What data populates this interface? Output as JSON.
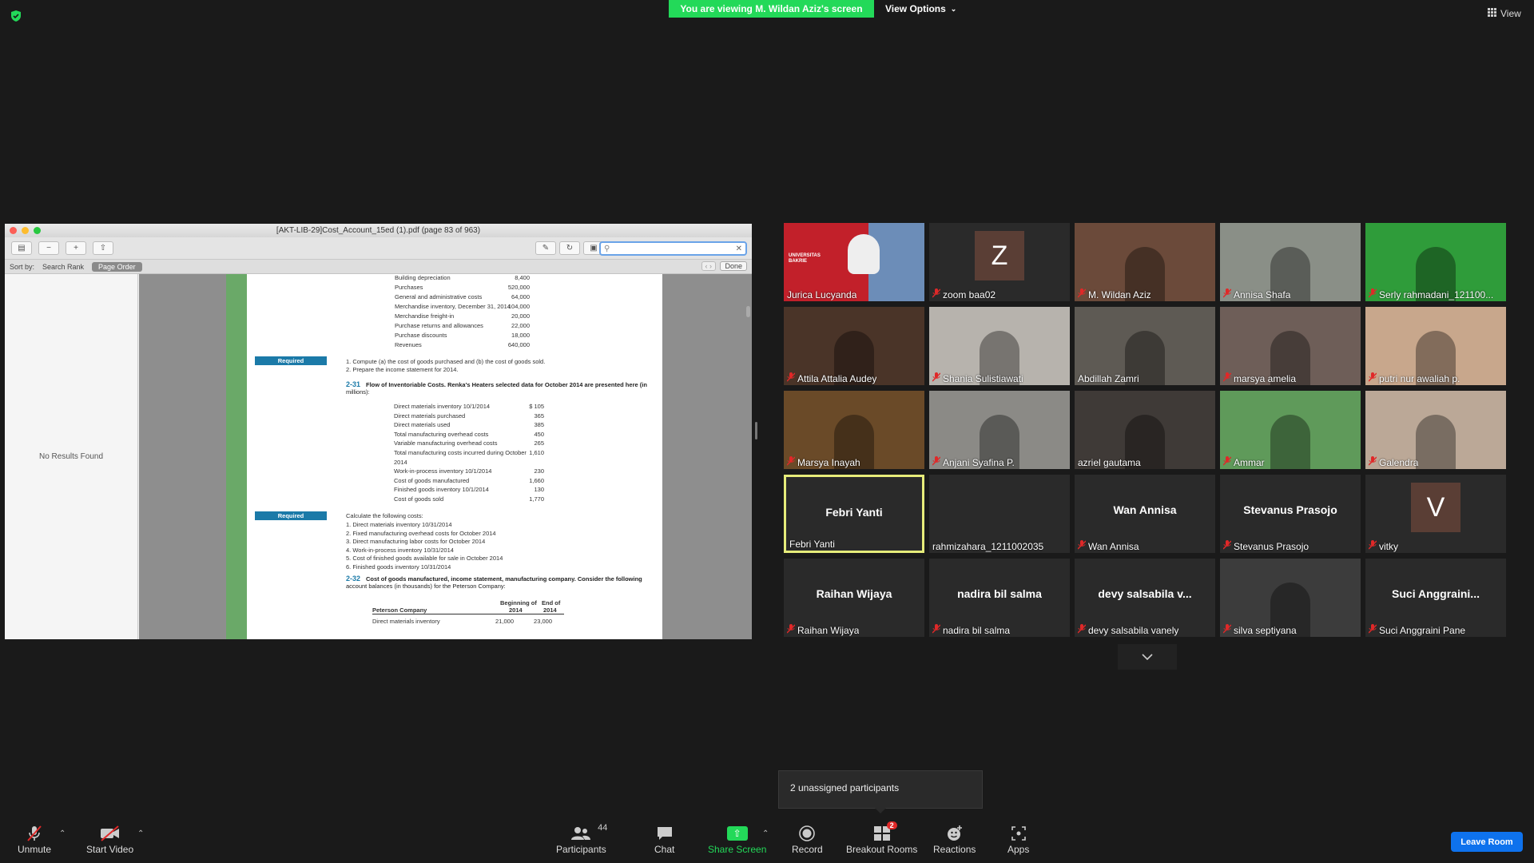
{
  "top": {
    "banner": "You are viewing M. Wildan Aziz's screen",
    "view_options": "View Options",
    "view": "View"
  },
  "shared_doc": {
    "title": "[AKT-LIB-29]Cost_Account_15ed (1).pdf (page 83 of 963)",
    "sort_by": "Sort by:",
    "sort_search_rank": "Search Rank",
    "sort_page_order": "Page Order",
    "done": "Done",
    "no_results": "No Results Found",
    "lines_top": [
      {
        "label": "Building depreciation",
        "value": "8,400"
      },
      {
        "label": "Purchases",
        "value": "520,000"
      },
      {
        "label": "General and administrative costs",
        "value": "64,000"
      },
      {
        "label": "Merchandise inventory, December 31, 2014",
        "value": "104,000"
      },
      {
        "label": "Merchandise freight-in",
        "value": "20,000"
      },
      {
        "label": "Purchase returns and allowances",
        "value": "22,000"
      },
      {
        "label": "Purchase discounts",
        "value": "18,000"
      },
      {
        "label": "Revenues",
        "value": "640,000"
      }
    ],
    "required_label": "Required",
    "req1_items": [
      "1. Compute (a) the cost of goods purchased and (b) the cost of goods sold.",
      "2. Prepare the income statement for 2014."
    ],
    "p231_num": "2-31",
    "p231_text": "Flow of Inventoriable Costs. Renka's Heaters selected data for October 2014 are presented here (in",
    "p231_text2": "millions):",
    "lines_231": [
      {
        "label": "Direct materials inventory 10/1/2014",
        "value": "$ 105"
      },
      {
        "label": "Direct materials purchased",
        "value": "365"
      },
      {
        "label": "Direct materials used",
        "value": "385"
      },
      {
        "label": "Total manufacturing overhead costs",
        "value": "450"
      },
      {
        "label": "Variable manufacturing overhead costs",
        "value": "265"
      },
      {
        "label": "Total manufacturing costs incurred during October",
        "value": "1,610"
      },
      {
        "label": "2014",
        "value": ""
      },
      {
        "label": "Work-in-process inventory 10/1/2014",
        "value": "230"
      },
      {
        "label": "Cost of goods manufactured",
        "value": "1,660"
      },
      {
        "label": "Finished goods inventory 10/1/2014",
        "value": "130"
      },
      {
        "label": "Cost of goods sold",
        "value": "1,770"
      }
    ],
    "calc_intro": "Calculate the following costs:",
    "req2_items": [
      "1. Direct materials inventory 10/31/2014",
      "2. Fixed manufacturing overhead costs for October 2014",
      "3. Direct manufacturing labor costs for October 2014",
      "4. Work-in-process inventory 10/31/2014",
      "5. Cost of finished goods available for sale in October 2014",
      "6. Finished goods inventory 10/31/2014"
    ],
    "p232_num": "2-32",
    "p232_text": "Cost of goods manufactured, income statement, manufacturing company. Consider the following",
    "p232_text2": "account balances (in thousands) for the Peterson Company:",
    "table_col1": "Beginning of",
    "table_col1b": "2014",
    "table_col2": "End of",
    "table_col2b": "2014",
    "table_company": "Peterson Company",
    "table_row1_label": "Direct materials inventory",
    "table_row1_v1": "21,000",
    "table_row1_v2": "23,000"
  },
  "participants_tiles": [
    {
      "name": "Jurica Lucyanda",
      "muted": false,
      "kind": "video",
      "bg": "#a31f1f"
    },
    {
      "name": "zoom baa02",
      "muted": true,
      "kind": "avatar",
      "initial": "Z"
    },
    {
      "name": "M. Wildan Aziz",
      "muted": true,
      "kind": "video",
      "bg": "#6b4a3a"
    },
    {
      "name": "Annisa Shafa",
      "muted": true,
      "kind": "video",
      "bg": "#8a8f87"
    },
    {
      "name": "Serly rahmadani_121100...",
      "muted": true,
      "kind": "video",
      "bg": "#2f9c3a"
    },
    {
      "name": "Attila Attalia Audey",
      "muted": true,
      "kind": "video",
      "bg": "#4a3428"
    },
    {
      "name": "Shania Sulistiawati",
      "muted": true,
      "kind": "video",
      "bg": "#b7b3ad"
    },
    {
      "name": "Abdillah Zamri",
      "muted": false,
      "kind": "video",
      "bg": "#5e5a54"
    },
    {
      "name": "marsya amelia",
      "muted": true,
      "kind": "video",
      "bg": "#6e5e58"
    },
    {
      "name": "putri nur awaliah p.",
      "muted": true,
      "kind": "video",
      "bg": "#c8a78c"
    },
    {
      "name": "Marsya Inayah",
      "muted": true,
      "kind": "video",
      "bg": "#6a4a28"
    },
    {
      "name": "Anjani Syafina P.",
      "muted": true,
      "kind": "video",
      "bg": "#8b8a86"
    },
    {
      "name": "azriel gautama",
      "muted": false,
      "kind": "video",
      "bg": "#3f3a37"
    },
    {
      "name": "Ammar",
      "muted": true,
      "kind": "video",
      "bg": "#5f9a5a"
    },
    {
      "name": "Galendra",
      "muted": true,
      "kind": "video",
      "bg": "#bba897"
    },
    {
      "name": "Febri Yanti",
      "muted": false,
      "kind": "name",
      "center": "Febri Yanti"
    },
    {
      "name": "rahmizahara_1211002035",
      "muted": false,
      "kind": "blank"
    },
    {
      "name": "Wan Annisa",
      "muted": true,
      "kind": "name",
      "center": "Wan Annisa"
    },
    {
      "name": "Stevanus Prasojo",
      "muted": true,
      "kind": "name",
      "center": "Stevanus Prasojo"
    },
    {
      "name": "vitky",
      "muted": true,
      "kind": "avatar",
      "initial": "V"
    },
    {
      "name": "Raihan Wijaya",
      "muted": true,
      "kind": "name",
      "center": "Raihan Wijaya"
    },
    {
      "name": "nadira bil salma",
      "muted": true,
      "kind": "name",
      "center": "nadira bil salma"
    },
    {
      "name": "devy salsabila vanely",
      "muted": true,
      "kind": "name",
      "center": "devy  salsabila  v..."
    },
    {
      "name": "silva septiyana",
      "muted": true,
      "kind": "video",
      "bg": "#3c3c3c"
    },
    {
      "name": "Suci Anggraini Pane",
      "muted": true,
      "kind": "name",
      "center": "Suci  Anggraini..."
    }
  ],
  "jurica_slide_text": "UNIVERSITAS BAKRIE",
  "toast": "2 unassigned participants",
  "toolbar": {
    "unmute": "Unmute",
    "start_video": "Start Video",
    "participants": "Participants",
    "participants_count": "44",
    "chat": "Chat",
    "share_screen": "Share Screen",
    "record": "Record",
    "breakout": "Breakout Rooms",
    "breakout_badge": "2",
    "reactions": "Reactions",
    "apps": "Apps",
    "leave": "Leave Room"
  },
  "colors": {
    "banner_green": "#23d959",
    "leave_blue": "#0e72ed",
    "muted_red": "#e02828",
    "active_speaker": "#e6ec7a"
  }
}
